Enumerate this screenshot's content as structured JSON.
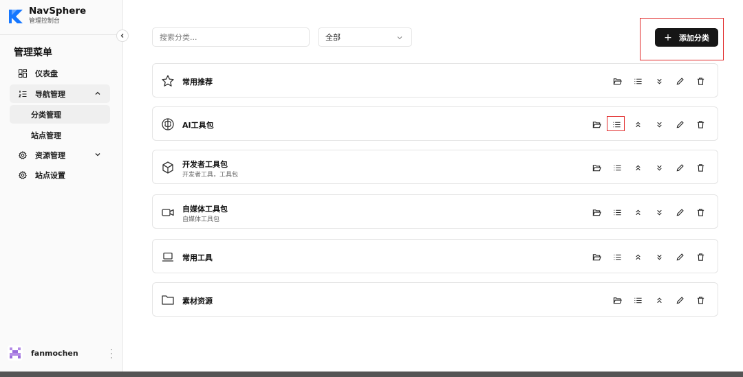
{
  "brand": {
    "name": "NavSphere",
    "subtitle": "管理控制台",
    "accent": "#1677ff"
  },
  "sidebar": {
    "menu_title": "管理菜单",
    "items": [
      {
        "label": "仪表盘",
        "icon": "dashboard-grid-icon"
      },
      {
        "label": "导航管理",
        "icon": "list-numbered-icon",
        "expanded": true,
        "children": [
          {
            "label": "分类管理",
            "active": true
          },
          {
            "label": "站点管理"
          }
        ]
      },
      {
        "label": "资源管理",
        "icon": "gear-icon",
        "expanded": false
      },
      {
        "label": "站点设置",
        "icon": "gear-icon"
      }
    ],
    "user": {
      "name": "fanmochen"
    }
  },
  "toolbar": {
    "search_placeholder": "搜索分类...",
    "filter_value": "全部",
    "add_label": "添加分类"
  },
  "categories": [
    {
      "name": "常用推荐",
      "desc": "",
      "icon": "star-icon"
    },
    {
      "name": "AI工具包",
      "desc": "",
      "icon": "brain-icon"
    },
    {
      "name": "开发者工具包",
      "desc": "开发者工具，工具包",
      "icon": "cube-icon"
    },
    {
      "name": "自媒体工具包",
      "desc": "自媒体工具包",
      "icon": "video-camera-icon"
    },
    {
      "name": "常用工具",
      "desc": "",
      "icon": "laptop-icon"
    },
    {
      "name": "素材资源",
      "desc": "",
      "icon": "folder-icon"
    }
  ],
  "colors": {
    "primary_button": "#161616",
    "highlight": "#e02424"
  }
}
